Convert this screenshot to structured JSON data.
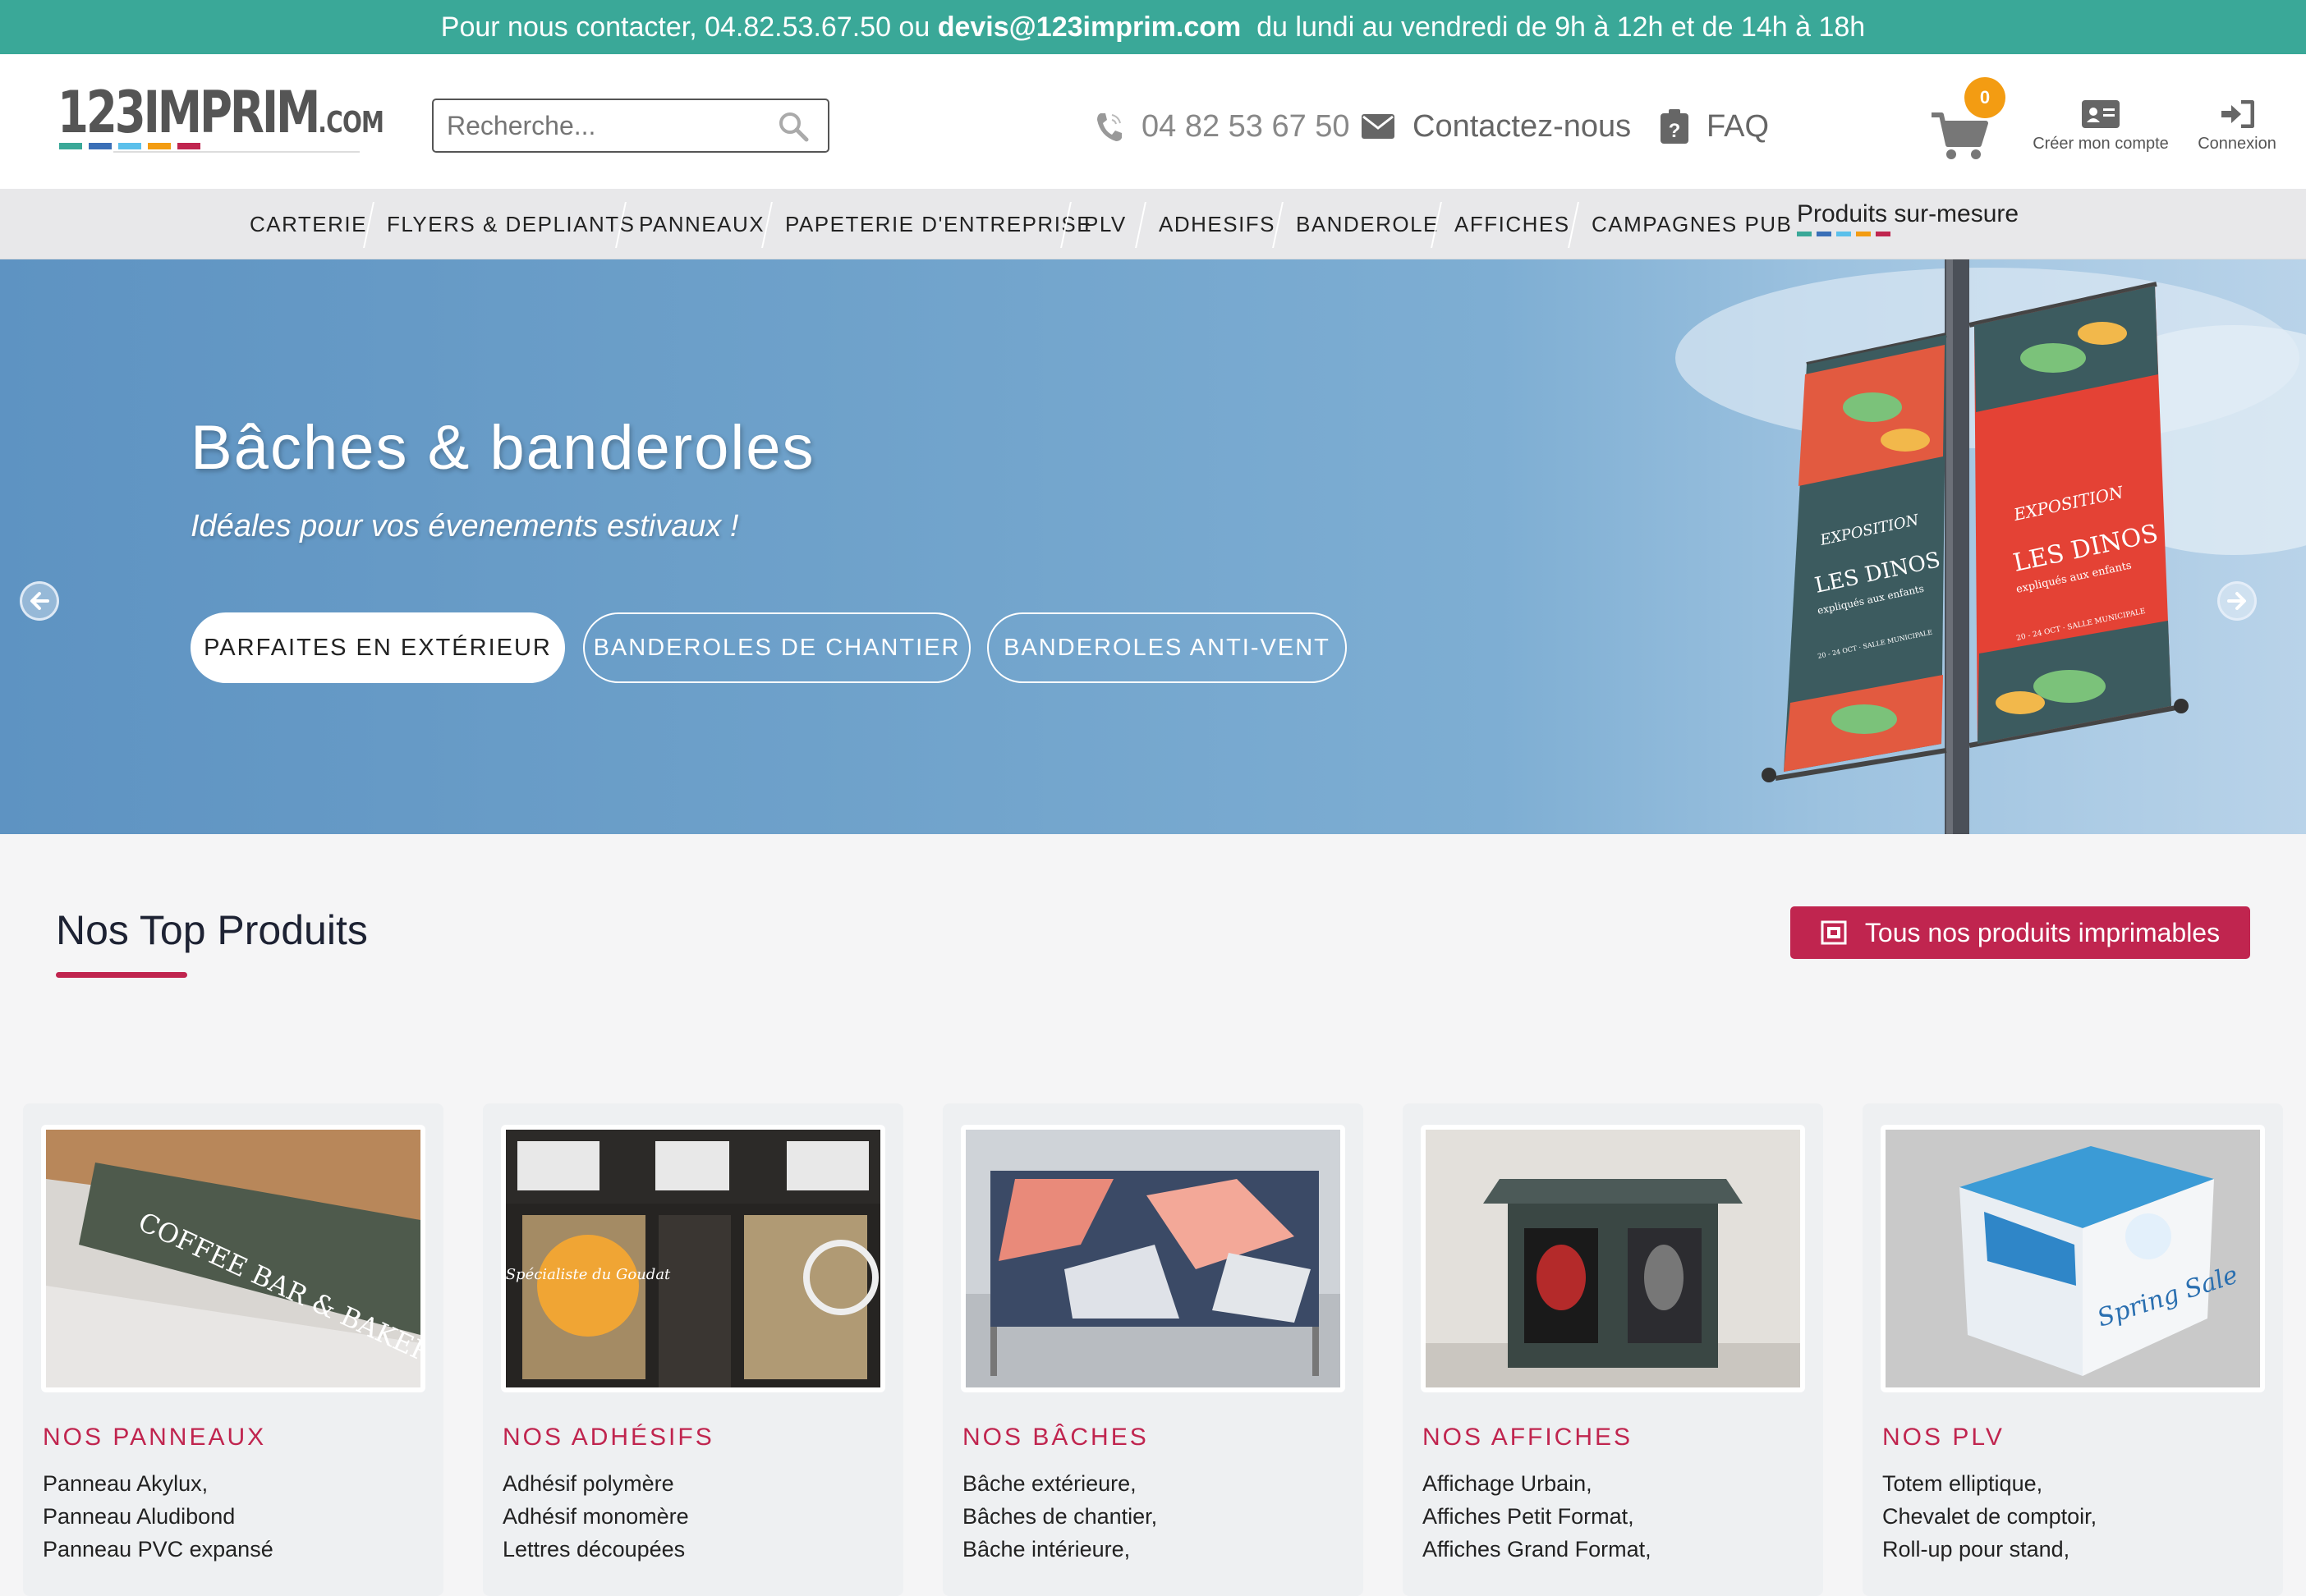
{
  "topbar": {
    "prefix": "Pour nous contacter, 04.82.53.67.50 ou ",
    "email": "devis@123imprim.com",
    "suffix": "  du lundi au vendredi de 9h à 12h et de 14h à 18h",
    "bg_color": "#3aa898"
  },
  "header": {
    "logo_main": "123IMPRIM",
    "logo_suffix": ".COM",
    "logo_colors": [
      "#3aa898",
      "#3a6fb7",
      "#5bc0eb",
      "#f39c12",
      "#c0254f"
    ],
    "search_placeholder": "Recherche...",
    "phone": "04 82 53 67 50",
    "contact": "Contactez-nous",
    "faq": "FAQ",
    "cart_count": "0",
    "account_label": "Créer mon compte",
    "login_label": "Connexion"
  },
  "nav": {
    "items": [
      "CARTERIE",
      "FLYERS & DEPLIANTS",
      "PANNEAUX",
      "PAPETERIE D'ENTREPRISE",
      "PLV",
      "ADHESIFS",
      "BANDEROLE",
      "AFFICHES",
      "CAMPAGNES PUB"
    ],
    "special": "Produits sur-mesure"
  },
  "hero": {
    "title": "Bâches & banderoles",
    "subtitle": "Idéales pour vos évenements estivaux !",
    "buttons": [
      "PARFAITES EN EXTÉRIEUR",
      "BANDEROLES DE CHANTIER",
      "BANDEROLES ANTI-VENT"
    ],
    "banner_left": {
      "line1": "EXPOSITION",
      "line2": "LES DINOS",
      "line3": "expliqués aux enfants",
      "line4": "20 - 24 OCT · SALLE MUNICIPALE"
    },
    "banner_right": {
      "line1": "EXPOSITION",
      "line2": "LES DINOS",
      "line3": "expliqués aux enfants",
      "line4": "20 - 24 OCT · SALLE MUNICIPALE"
    }
  },
  "products": {
    "title": "Nos Top Produits",
    "all_button": "Tous nos produits imprimables",
    "accent_color": "#c0254f",
    "cards": [
      {
        "title": "NOS PANNEAUX",
        "lines": [
          "Panneau Akylux,",
          "Panneau Aludibond",
          "Panneau PVC expansé"
        ],
        "image_text": "COFFEE BAR & BAKERY"
      },
      {
        "title": "NOS ADHÉSIFS",
        "lines": [
          "Adhésif polymère",
          "Adhésif monomère",
          "Lettres découpées"
        ],
        "image_text": "Spécialiste du Goudat"
      },
      {
        "title": "NOS BÂCHES",
        "lines": [
          "Bâche extérieure,",
          "Bâches de chantier,",
          "Bâche intérieure,"
        ],
        "image_text": ""
      },
      {
        "title": "NOS AFFICHES",
        "lines": [
          "Affichage Urbain,",
          "Affiches Petit Format,",
          "Affiches Grand Format,"
        ],
        "image_text": ""
      },
      {
        "title": "NOS PLV",
        "lines": [
          "Totem elliptique,",
          "Chevalet de comptoir,",
          "Roll-up pour stand,"
        ],
        "image_text": "Spring Sale"
      }
    ]
  }
}
